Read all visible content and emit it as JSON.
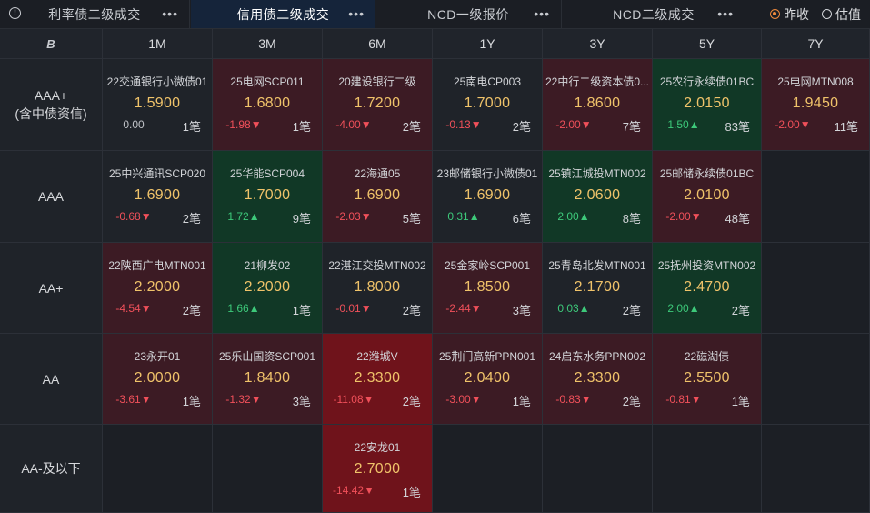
{
  "tabs": [
    {
      "label": "利率债二级成交",
      "active": false,
      "has_info": true
    },
    {
      "label": "信用债二级成交",
      "active": true,
      "has_info": false
    },
    {
      "label": "NCD一级报价",
      "active": false,
      "has_info": false
    },
    {
      "label": "NCD二级成交",
      "active": false,
      "has_info": false
    }
  ],
  "tab_menu_glyph": "•••",
  "radio": {
    "options": [
      "昨收",
      "估值"
    ],
    "selected": "昨收"
  },
  "corner_label": "B",
  "columns": [
    "1M",
    "3M",
    "6M",
    "1Y",
    "3Y",
    "5Y",
    "7Y"
  ],
  "rows": [
    {
      "label_lines": [
        "AAA+",
        "(含中债资信)"
      ],
      "cells": [
        {
          "name": "22交通银行小微债01",
          "price": "1.5900",
          "change": "0.00",
          "dir": "flat",
          "count": "1笔",
          "color": "dark"
        },
        {
          "name": "25电网SCP011",
          "price": "1.6800",
          "change": "-1.98▼",
          "dir": "down",
          "count": "1笔",
          "color": "red"
        },
        {
          "name": "20建设银行二级",
          "price": "1.7200",
          "change": "-4.00▼",
          "dir": "down",
          "count": "2笔",
          "color": "red"
        },
        {
          "name": "25南电CP003",
          "price": "1.7000",
          "change": "-0.13▼",
          "dir": "down",
          "count": "2笔",
          "color": "dark"
        },
        {
          "name": "22中行二级资本债0...",
          "price": "1.8600",
          "change": "-2.00▼",
          "dir": "down",
          "count": "7笔",
          "color": "red"
        },
        {
          "name": "25农行永续债01BC",
          "price": "2.0150",
          "change": "1.50▲",
          "dir": "up",
          "count": "83笔",
          "color": "green"
        },
        {
          "name": "25电网MTN008",
          "price": "1.9450",
          "change": "-2.00▼",
          "dir": "down",
          "count": "11笔",
          "color": "red"
        }
      ]
    },
    {
      "label_lines": [
        "AAA"
      ],
      "cells": [
        {
          "name": "25中兴通讯SCP020",
          "price": "1.6900",
          "change": "-0.68▼",
          "dir": "down",
          "count": "2笔",
          "color": "dark"
        },
        {
          "name": "25华能SCP004",
          "price": "1.7000",
          "change": "1.72▲",
          "dir": "up",
          "count": "9笔",
          "color": "green"
        },
        {
          "name": "22海通05",
          "price": "1.6900",
          "change": "-2.03▼",
          "dir": "down",
          "count": "5笔",
          "color": "red"
        },
        {
          "name": "23邮储银行小微债01",
          "price": "1.6900",
          "change": "0.31▲",
          "dir": "up",
          "count": "6笔",
          "color": "dark"
        },
        {
          "name": "25镇江城投MTN002",
          "price": "2.0600",
          "change": "2.00▲",
          "dir": "up",
          "count": "8笔",
          "color": "green"
        },
        {
          "name": "25邮储永续债01BC",
          "price": "2.0100",
          "change": "-2.00▼",
          "dir": "down",
          "count": "48笔",
          "color": "red"
        },
        null
      ]
    },
    {
      "label_lines": [
        "AA+"
      ],
      "cells": [
        {
          "name": "22陕西广电MTN001",
          "price": "2.2000",
          "change": "-4.54▼",
          "dir": "down",
          "count": "2笔",
          "color": "red"
        },
        {
          "name": "21柳发02",
          "price": "2.2000",
          "change": "1.66▲",
          "dir": "up",
          "count": "1笔",
          "color": "green"
        },
        {
          "name": "22湛江交投MTN002",
          "price": "1.8000",
          "change": "-0.01▼",
          "dir": "down",
          "count": "2笔",
          "color": "dark"
        },
        {
          "name": "25金家岭SCP001",
          "price": "1.8500",
          "change": "-2.44▼",
          "dir": "down",
          "count": "3笔",
          "color": "red"
        },
        {
          "name": "25青岛北发MTN001",
          "price": "2.1700",
          "change": "0.03▲",
          "dir": "up",
          "count": "2笔",
          "color": "dark"
        },
        {
          "name": "25抚州投资MTN002",
          "price": "2.4700",
          "change": "2.00▲",
          "dir": "up",
          "count": "2笔",
          "color": "green"
        },
        null
      ]
    },
    {
      "label_lines": [
        "AA"
      ],
      "cells": [
        {
          "name": "23永开01",
          "price": "2.0000",
          "change": "-3.61▼",
          "dir": "down",
          "count": "1笔",
          "color": "red"
        },
        {
          "name": "25乐山国资SCP001",
          "price": "1.8400",
          "change": "-1.32▼",
          "dir": "down",
          "count": "3笔",
          "color": "red"
        },
        {
          "name": "22潍城V",
          "price": "2.3300",
          "change": "-11.08▼",
          "dir": "down",
          "count": "2笔",
          "color": "hot"
        },
        {
          "name": "25荆门高新PPN001",
          "price": "2.0400",
          "change": "-3.00▼",
          "dir": "down",
          "count": "1笔",
          "color": "red"
        },
        {
          "name": "24启东水务PPN002",
          "price": "2.3300",
          "change": "-0.83▼",
          "dir": "down",
          "count": "2笔",
          "color": "red"
        },
        {
          "name": "22磁湖债",
          "price": "2.5500",
          "change": "-0.81▼",
          "dir": "down",
          "count": "1笔",
          "color": "red"
        },
        null
      ]
    },
    {
      "label_lines": [
        "AA-及以下"
      ],
      "cells": [
        null,
        null,
        {
          "name": "22安龙01",
          "price": "2.7000",
          "change": "-14.42▼",
          "dir": "down",
          "count": "1笔",
          "color": "hot"
        },
        null,
        null,
        null,
        null
      ]
    }
  ],
  "colors": {
    "price": "#f0c36a",
    "up": "#3dc97a",
    "down": "#f0505a",
    "green_cell": "#113826",
    "red_cell": "#3c1b24",
    "hot_cell": "#6f131b",
    "accent": "#f08a3c"
  }
}
